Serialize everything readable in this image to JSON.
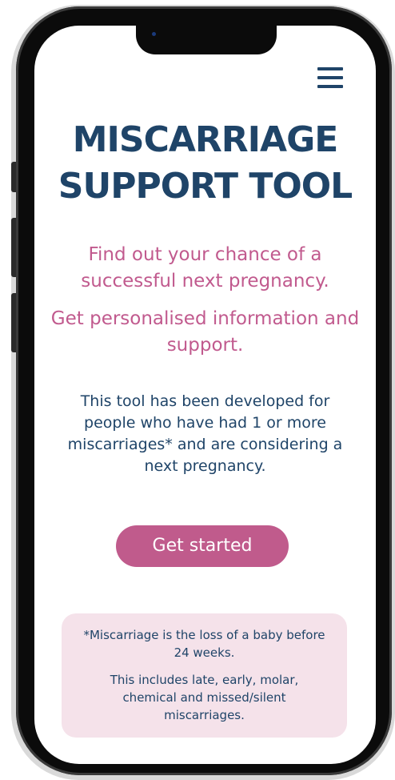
{
  "header": {
    "menu_icon": "hamburger-menu-icon"
  },
  "hero": {
    "title_line1": "MISCARRIAGE",
    "title_line2": "SUPPORT TOOL",
    "intro_1": "Find out your chance of a successful next pregnancy.",
    "intro_2": "Get personalised information and support.",
    "description": "This tool has been developed for people who have had 1 or more miscarriages* and are considering a next pregnancy."
  },
  "actions": {
    "get_started_label": "Get started"
  },
  "footnote": {
    "definition": "*Miscarriage is the loss of a baby before 24 weeks.",
    "includes": "This includes late, early, molar, chemical and missed/silent miscarriages."
  },
  "colors": {
    "navy": "#1f4468",
    "pink": "#c05b8c",
    "note_background": "#f5e2ea"
  }
}
